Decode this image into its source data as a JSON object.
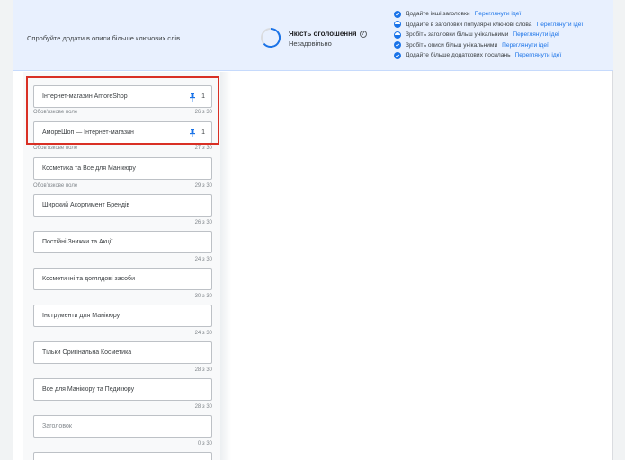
{
  "banner": {
    "tip": "Спробуйте додати в описи більше ключових слів",
    "quality_title": "Якість оголошення",
    "quality_value": "Незадовільно"
  },
  "recommendations": [
    {
      "text": "Додайте інші заголовки",
      "link": "Переглянути ідеї",
      "icon": "check-circle-icon"
    },
    {
      "text": "Додайте в заголовки популярні ключові слова",
      "link": "Переглянути ідеї",
      "icon": "half-circle-icon"
    },
    {
      "text": "Зробіть заголовки більш унікальними",
      "link": "Переглянути ідеї",
      "icon": "half-circle-icon"
    },
    {
      "text": "Зробіть описи більш унікальними",
      "link": "Переглянути ідеї",
      "icon": "check-circle-icon"
    },
    {
      "text": "Додайте більше додаткових посилань",
      "link": "Переглянути ідеї",
      "icon": "check-circle-icon"
    }
  ],
  "headlines": [
    {
      "value": "Інтернет-магазин AmoreShop",
      "required": "Обов'язкове поле",
      "count": "26 з 30",
      "pinned": "1"
    },
    {
      "value": "АмореШоп — Інтернет-магазин",
      "required": "Обов'язкове поле",
      "count": "27 з 30",
      "pinned": "1"
    },
    {
      "value": "Косметика та Все для Манікюру",
      "required": "Обов'язкове поле",
      "count": "29 з 30"
    },
    {
      "value": "Широкий Асортимент Брендів",
      "count": "26 з 30"
    },
    {
      "value": "Постійні Знижки та Акції",
      "count": "24 з 30"
    },
    {
      "value": "Косметичні та доглядові засоби",
      "count": "30 з 30"
    },
    {
      "value": "Інструменти для Манікюру",
      "count": "24 з 30"
    },
    {
      "value": "Тільки Оригінальна Косметика",
      "count": "28 з 30"
    },
    {
      "value": "Все для Манікюру та Педикюру",
      "count": "28 з 30"
    },
    {
      "value": "",
      "placeholder": "Заголовок",
      "count": "0 з 30"
    }
  ],
  "colors": {
    "accent": "#1a73e8",
    "highlight": "#d93025",
    "banner": "#e8f0fe"
  }
}
